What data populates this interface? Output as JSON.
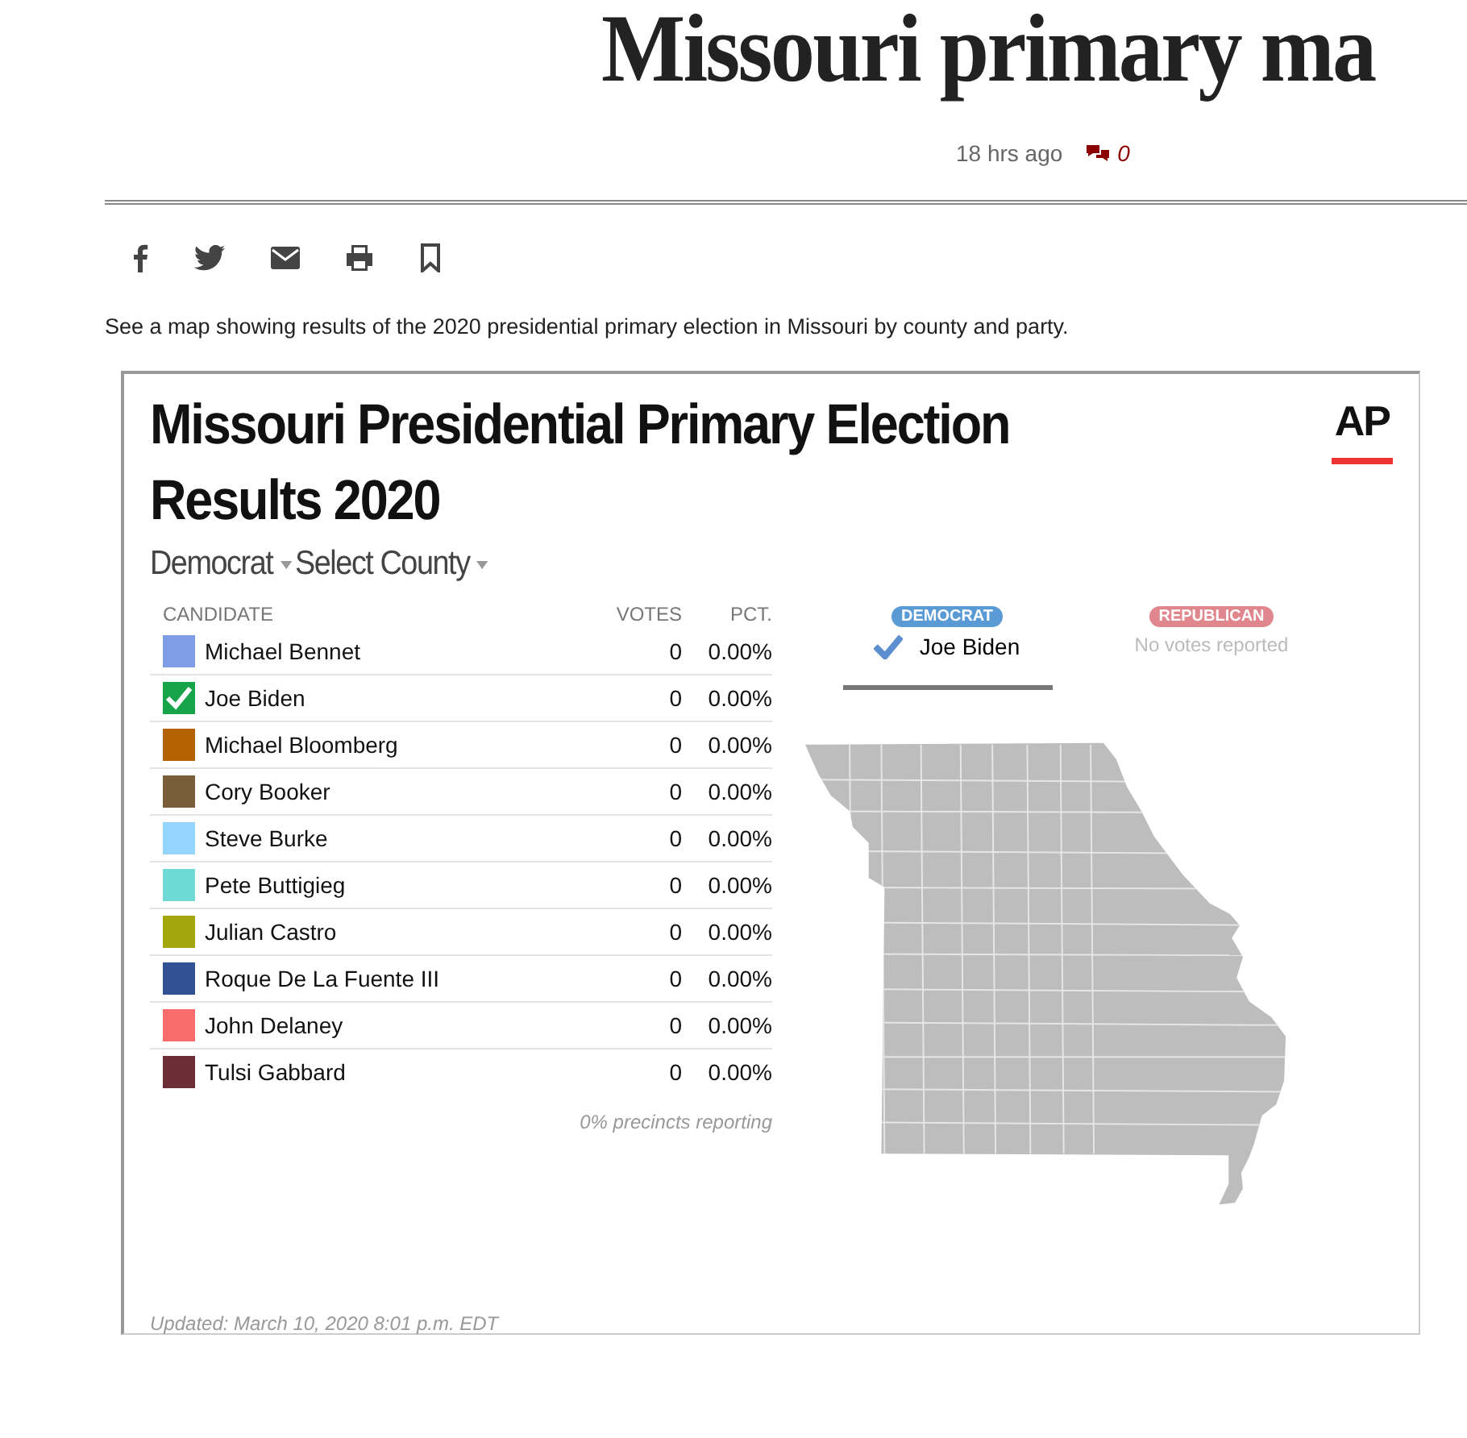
{
  "article": {
    "headline": "Missouri primary ma",
    "time": "18 hrs ago",
    "comment_count": "0",
    "summary": "See a map showing results of the 2020 presidential primary election in Missouri by county and party."
  },
  "share_icons": [
    {
      "kind": "facebook"
    },
    {
      "kind": "twitter"
    },
    {
      "kind": "email"
    },
    {
      "kind": "print"
    },
    {
      "kind": "bookmark"
    }
  ],
  "widget": {
    "title": "Missouri Presidential Primary Election Results 2020",
    "logo": "AP",
    "filters": [
      "Democrat",
      "Select County"
    ],
    "columns": [
      "CANDIDATE",
      "VOTES",
      "PCT."
    ],
    "candidates": [
      {
        "name": "Michael Bennet",
        "votes": "0",
        "pct": "0.00%",
        "color": "#7f9de6",
        "winner": false
      },
      {
        "name": "Joe Biden",
        "votes": "0",
        "pct": "0.00%",
        "color": "#16a34a",
        "winner": true
      },
      {
        "name": "Michael Bloomberg",
        "votes": "0",
        "pct": "0.00%",
        "color": "#b26200",
        "winner": false
      },
      {
        "name": "Cory Booker",
        "votes": "0",
        "pct": "0.00%",
        "color": "#7a5e3a",
        "winner": false
      },
      {
        "name": "Steve Burke",
        "votes": "0",
        "pct": "0.00%",
        "color": "#93d5ff",
        "winner": false
      },
      {
        "name": "Pete Buttigieg",
        "votes": "0",
        "pct": "0.00%",
        "color": "#6fd9d6",
        "winner": false
      },
      {
        "name": "Julian Castro",
        "votes": "0",
        "pct": "0.00%",
        "color": "#a3a70b",
        "winner": false
      },
      {
        "name": "Roque De La Fuente III",
        "votes": "0",
        "pct": "0.00%",
        "color": "#325195",
        "winner": false
      },
      {
        "name": "John Delaney",
        "votes": "0",
        "pct": "0.00%",
        "color": "#f86c6c",
        "winner": false
      },
      {
        "name": "Tulsi Gabbard",
        "votes": "0",
        "pct": "0.00%",
        "color": "#6c2d36",
        "winner": false
      }
    ],
    "precincts": "0% precincts reporting",
    "updated": "Updated: March 10, 2020 8:01 p.m. EDT",
    "parties": [
      {
        "label": "DEMOCRAT",
        "color": "#5b9bd5",
        "selected": true,
        "winner": "Joe Biden"
      },
      {
        "label": "REPUBLICAN",
        "color": "#e0878d",
        "selected": false,
        "note": "No votes reported"
      }
    ]
  }
}
